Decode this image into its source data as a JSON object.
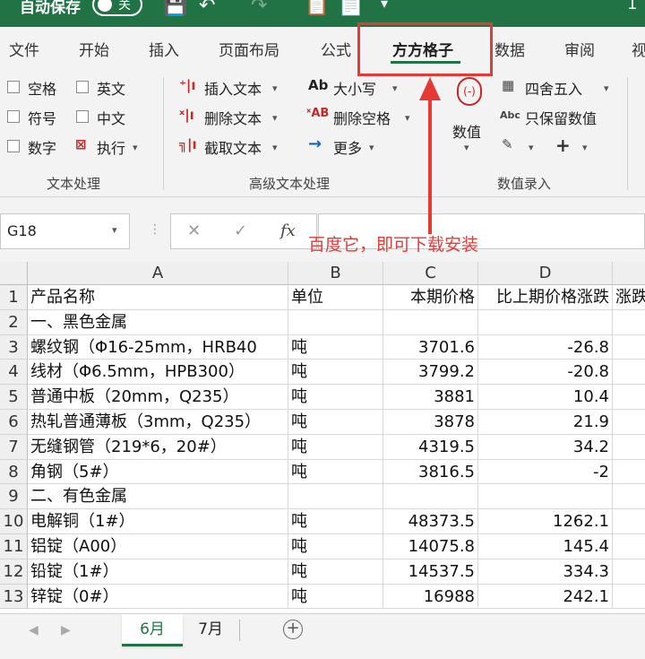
{
  "titlebar": {
    "autosave_label": "自动保存",
    "autosave_state": "关",
    "window_num": "1"
  },
  "tabs": [
    {
      "label": "文件"
    },
    {
      "label": "开始"
    },
    {
      "label": "插入"
    },
    {
      "label": "页面布局"
    },
    {
      "label": "公式"
    },
    {
      "label": "方方格子"
    },
    {
      "label": "数据"
    },
    {
      "label": "审阅"
    },
    {
      "label": "视"
    }
  ],
  "ribbon": {
    "text_group": {
      "checkbox_space": "空格",
      "checkbox_english": "英文",
      "checkbox_symbol": "符号",
      "checkbox_chinese": "中文",
      "checkbox_number": "数字",
      "execute": "执行",
      "label": "文本处理"
    },
    "advanced_group": {
      "insert_text": "插入文本",
      "delete_text": "删除文本",
      "cut_text": "截取文本",
      "case": "大小写",
      "delete_space": "删除空格",
      "more": "更多",
      "label": "高级文本处理"
    },
    "value_group": {
      "value_btn": "数值",
      "round": "四舍五入",
      "keep_value": "只保留数值",
      "label": "数值录入"
    }
  },
  "formula_bar": {
    "name_box": "G18",
    "fx": "fx",
    "value": ""
  },
  "annotation": "百度它，即可下载安装",
  "grid": {
    "columns": [
      "A",
      "B",
      "C",
      "D"
    ],
    "rows": [
      {
        "num": "1",
        "a": "产品名称",
        "b": "单位",
        "c": "本期价格",
        "d": "比上期价格涨跌",
        "e": "涨跌"
      },
      {
        "num": "2",
        "a": "一、黑色金属",
        "b": "",
        "c": "",
        "d": "",
        "e": ""
      },
      {
        "num": "3",
        "a": "螺纹钢（Φ16-25mm，HRB40",
        "b": "吨",
        "c": "3701.6",
        "d": "-26.8",
        "e": ""
      },
      {
        "num": "4",
        "a": "线材（Φ6.5mm，HPB300）",
        "b": "吨",
        "c": "3799.2",
        "d": "-20.8",
        "e": ""
      },
      {
        "num": "5",
        "a": "普通中板（20mm，Q235）",
        "b": "吨",
        "c": "3881",
        "d": "10.4",
        "e": ""
      },
      {
        "num": "6",
        "a": "热轧普通薄板（3mm，Q235）",
        "b": "吨",
        "c": "3878",
        "d": "21.9",
        "e": ""
      },
      {
        "num": "7",
        "a": "无缝钢管（219*6，20#）",
        "b": "吨",
        "c": "4319.5",
        "d": "34.2",
        "e": ""
      },
      {
        "num": "8",
        "a": "角钢（5#）",
        "b": "吨",
        "c": "3816.5",
        "d": "-2",
        "e": ""
      },
      {
        "num": "9",
        "a": "二、有色金属",
        "b": "",
        "c": "",
        "d": "",
        "e": ""
      },
      {
        "num": "10",
        "a": "电解铜（1#）",
        "b": "吨",
        "c": "48373.5",
        "d": "1262.1",
        "e": ""
      },
      {
        "num": "11",
        "a": "铝锭（A00）",
        "b": "吨",
        "c": "14075.8",
        "d": "145.4",
        "e": ""
      },
      {
        "num": "12",
        "a": "铅锭（1#）",
        "b": "吨",
        "c": "14537.5",
        "d": "334.3",
        "e": ""
      },
      {
        "num": "13",
        "a": "锌锭（0#）",
        "b": "吨",
        "c": "16988",
        "d": "242.1",
        "e": ""
      }
    ]
  },
  "sheets": [
    {
      "label": "6月",
      "active": true
    },
    {
      "label": "7月",
      "active": false
    }
  ],
  "colors": {
    "excel_green": "#217346",
    "annotation_red": "#e53935"
  }
}
